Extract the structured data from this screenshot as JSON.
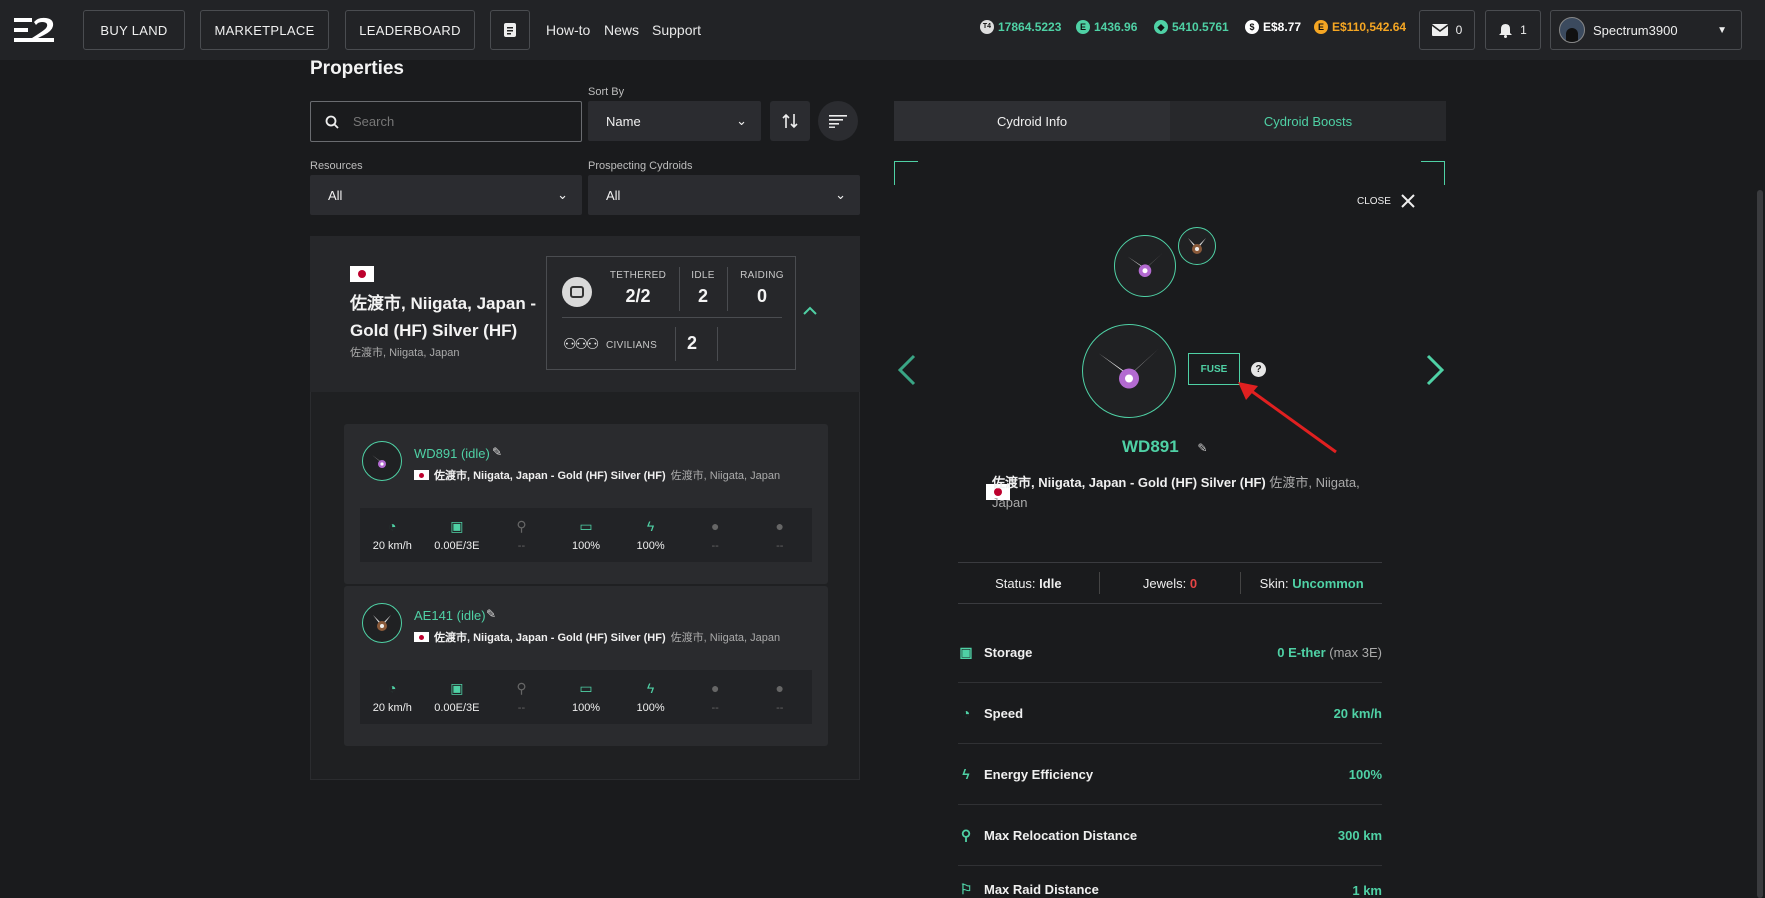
{
  "header": {
    "nav": [
      "BUY LAND",
      "MARKETPLACE",
      "LEADERBOARD"
    ],
    "links": [
      "How-to",
      "News",
      "Support"
    ],
    "balances": [
      {
        "icon": "t4-token-icon",
        "glyph": "T4",
        "value": "17864.5223",
        "color": "#4fd1a5"
      },
      {
        "icon": "ecredit-icon",
        "glyph": "E",
        "value": "1436.96",
        "color": "#4fd1a5"
      },
      {
        "icon": "ether-icon",
        "glyph": "◆",
        "value": "5410.5761",
        "color": "#4fd1a5"
      },
      {
        "icon": "dollar-icon",
        "glyph": "$",
        "value": "E$8.77",
        "color": "#ffffff"
      },
      {
        "icon": "gold-coin-icon",
        "glyph": "E",
        "value": "E$110,542.64",
        "color": "#f5a623"
      }
    ],
    "mail_count": "0",
    "notif_count": "1",
    "username": "Spectrum3900"
  },
  "properties": {
    "title": "Properties",
    "search_placeholder": "Search",
    "sort_label": "Sort By",
    "sort_value": "Name",
    "resources_label": "Resources",
    "resources_value": "All",
    "prospecting_label": "Prospecting Cydroids",
    "prospecting_value": "All"
  },
  "land": {
    "title": "佐渡市, Niigata, Japan - Gold (HF) Silver (HF)",
    "subtitle": "佐渡市, Niigata, Japan",
    "tethered_label": "TETHERED",
    "tethered_value": "2/2",
    "idle_label": "IDLE",
    "idle_value": "2",
    "raiding_label": "RAIDING",
    "raiding_value": "0",
    "civilians_label": "CIVILIANS",
    "civilians_value": "2"
  },
  "cydroids": [
    {
      "name": "WD891 (idle)",
      "loc_bold": "佐渡市, Niigata, Japan - Gold (HF) Silver (HF)",
      "loc_gray": "佐渡市, Niigata, Japan",
      "stats": [
        "20 km/h",
        "0.00E/3E",
        "--",
        "100%",
        "100%",
        "--",
        "--"
      ]
    },
    {
      "name": "AE141 (idle)",
      "loc_bold": "佐渡市, Niigata, Japan - Gold (HF) Silver (HF)",
      "loc_gray": "佐渡市, Niigata, Japan",
      "stats": [
        "20 km/h",
        "0.00E/3E",
        "--",
        "100%",
        "100%",
        "--",
        "--"
      ]
    }
  ],
  "detail": {
    "tab_info": "Cydroid Info",
    "tab_boosts": "Cydroid Boosts",
    "close": "CLOSE",
    "fuse": "FUSE",
    "help": "?",
    "name": "WD891",
    "loc_bold": "佐渡市, Niigata, Japan - Gold (HF) Silver (HF)",
    "loc_gray": "佐渡市, Niigata,",
    "loc_gray2": "Japan",
    "status_label": "Status:",
    "status_value": "Idle",
    "jewels_label": "Jewels:",
    "jewels_value": "0",
    "skin_label": "Skin:",
    "skin_value": "Uncommon",
    "attrs": [
      {
        "label": "Storage",
        "value": "0 E-ther",
        "extra": " (max 3E)"
      },
      {
        "label": "Speed",
        "value": "20 km/h",
        "extra": ""
      },
      {
        "label": "Energy Efficiency",
        "value": "100%",
        "extra": ""
      },
      {
        "label": "Max Relocation Distance",
        "value": "300 km",
        "extra": ""
      },
      {
        "label": "Max Raid Distance",
        "value": "1 km",
        "extra": ""
      }
    ]
  },
  "colors": {
    "accent": "#4fd1a5",
    "jewels": "#e64545",
    "arrow": "#e02020"
  }
}
